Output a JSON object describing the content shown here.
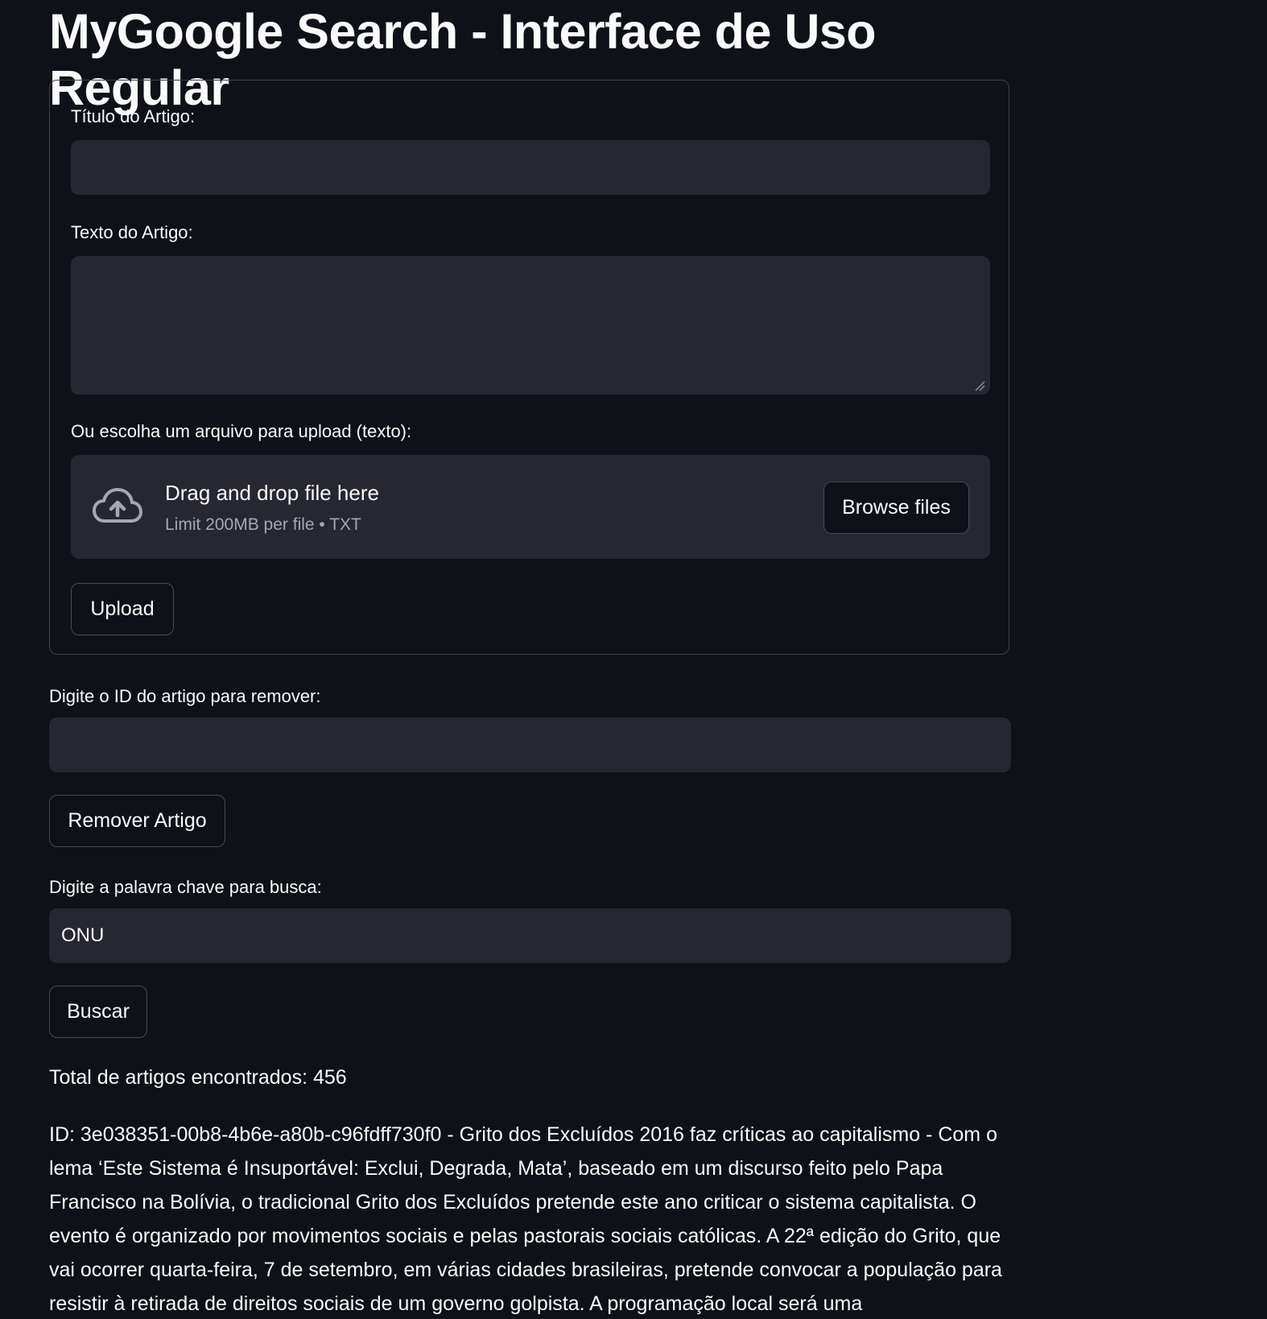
{
  "page": {
    "title": "MyGoogle Search - Interface de Uso Regular"
  },
  "upload_form": {
    "title_label": "Título do Artigo:",
    "title_value": "",
    "text_label": "Texto do Artigo:",
    "text_value": "",
    "file_label": "Ou escolha um arquivo para upload (texto):",
    "dropzone": {
      "main_text": "Drag and drop file here",
      "sub_text": "Limit 200MB per file • TXT",
      "icon": "cloud-upload-icon",
      "browse_label": "Browse files"
    },
    "upload_label": "Upload"
  },
  "remove_form": {
    "id_label": "Digite o ID do artigo para remover:",
    "id_value": "",
    "remove_label": "Remover Artigo"
  },
  "search_form": {
    "keyword_label": "Digite a palavra chave para busca:",
    "keyword_value": "ONU",
    "search_label": "Buscar"
  },
  "results": {
    "total_text": "Total de artigos encontrados: 456",
    "first_result": "ID: 3e038351-00b8-4b6e-a80b-c96fdff730f0 - Grito dos Excluídos 2016 faz críticas ao capitalismo - Com o lema ‘Este Sistema é Insuportável: Exclui, Degrada, Mata’, baseado em um discurso feito pelo Papa Francisco na Bolívia, o tradicional Grito dos Excluídos pretende este ano criticar o sistema capitalista. O evento é organizado por movimentos sociais e pelas pastorais sociais católicas. A 22ª edição do Grito, que vai ocorrer quarta-feira, 7 de setembro, em várias cidades brasileiras, pretende convocar a população para resistir à retirada de direitos sociais de um governo golpista. A programação local será uma"
  },
  "colors": {
    "background": "#0e1117",
    "input_background": "#262730",
    "border": "#3d4049",
    "text": "#fafafa",
    "muted_text": "#a3a8b4"
  }
}
